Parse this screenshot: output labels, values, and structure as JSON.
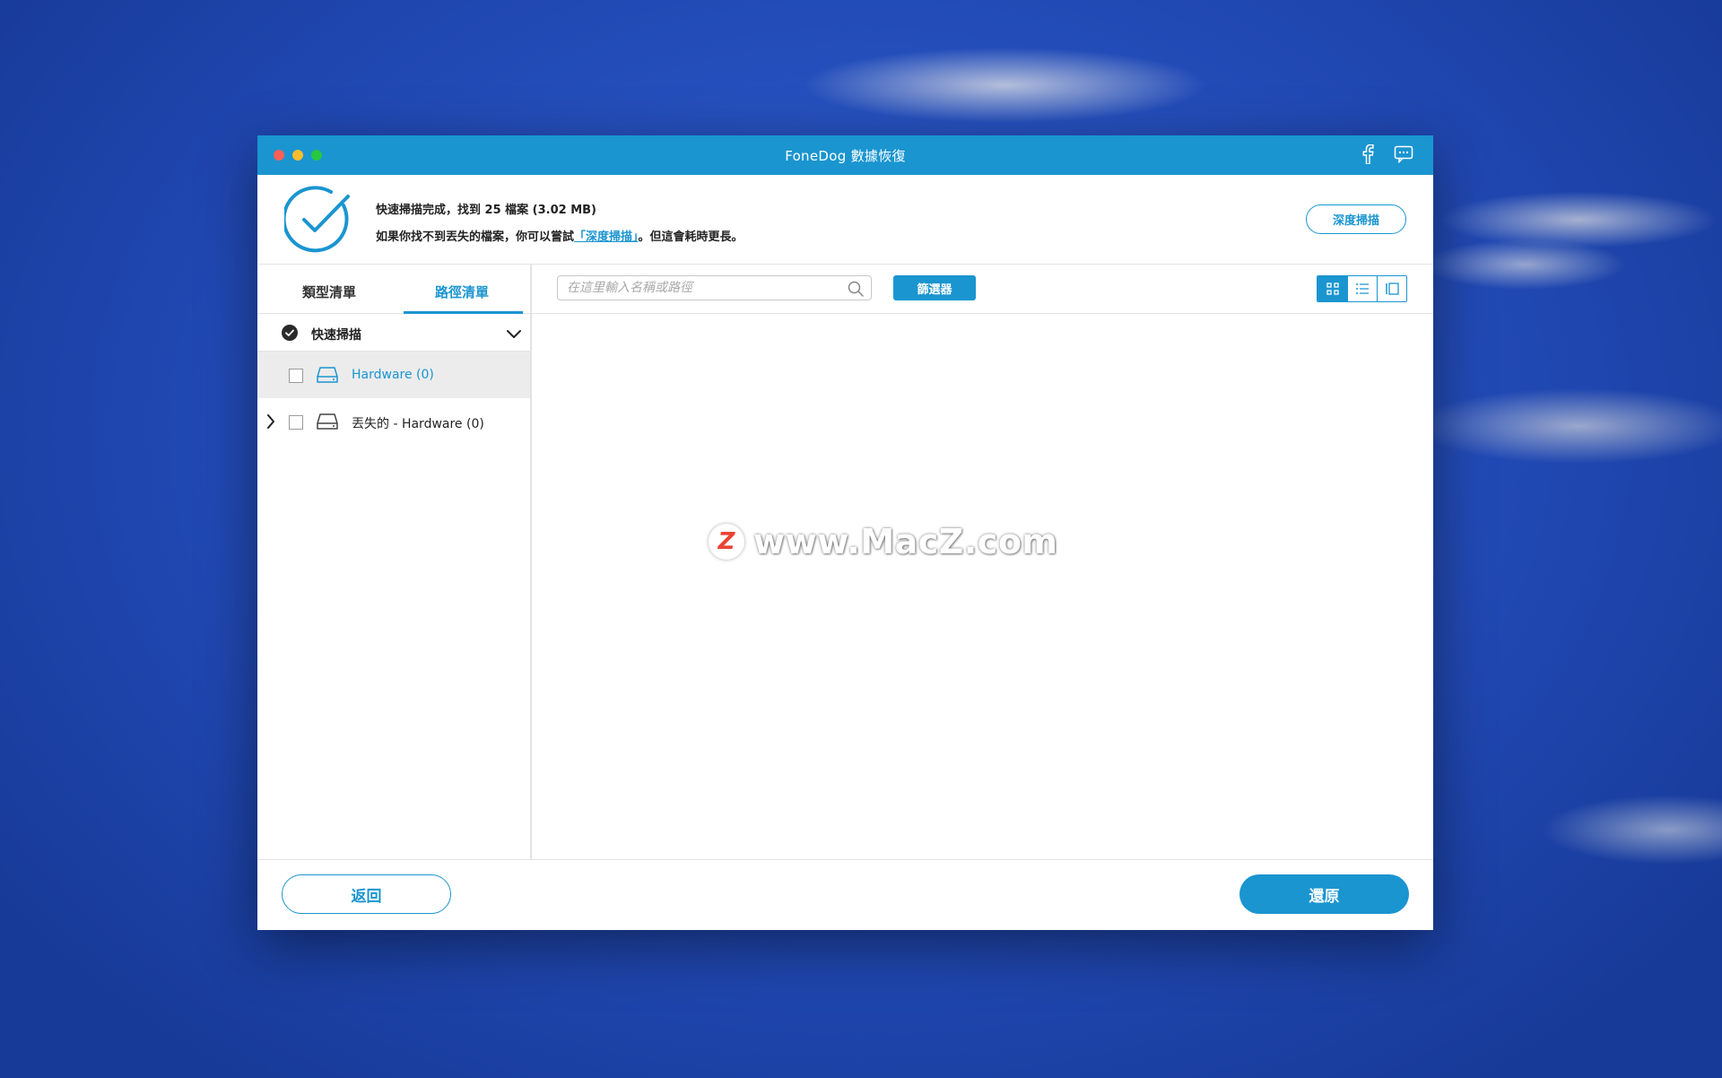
{
  "window": {
    "title": "FoneDog 數據恢復"
  },
  "summary": {
    "line1": "快速掃描完成，找到 25 檔案 (3.02 MB)",
    "line2_prefix": "如果你找不到丟失的檔案，你可以嘗試",
    "line2_link": "「深度掃描」",
    "line2_suffix": "。但這會耗時更長。",
    "deep_scan_button": "深度掃描"
  },
  "sidebar": {
    "tabs": [
      {
        "label": "類型清單",
        "active": false
      },
      {
        "label": "路徑清單",
        "active": true
      }
    ],
    "scan_group": {
      "label": "快速掃描",
      "checked": true
    },
    "items": [
      {
        "label": "Hardware (0)",
        "selected": true,
        "expandable": false,
        "checked": false
      },
      {
        "label": "丟失的 - Hardware (0)",
        "selected": false,
        "expandable": true,
        "checked": false
      }
    ]
  },
  "toolbar": {
    "search_placeholder": "在這里輸入名稱或路徑",
    "filter_button": "篩選器",
    "view_modes": [
      "grid-view-icon",
      "list-view-icon",
      "column-view-icon"
    ],
    "active_view": "grid-view-icon"
  },
  "watermark": {
    "logo_letter": "Z",
    "text": "www.MacZ.com"
  },
  "footer": {
    "back_button": "返回",
    "restore_button": "還原"
  },
  "colors": {
    "accent": "#1a95d0",
    "titlebar": "#1a95d0",
    "desktop": "#2149b4"
  }
}
